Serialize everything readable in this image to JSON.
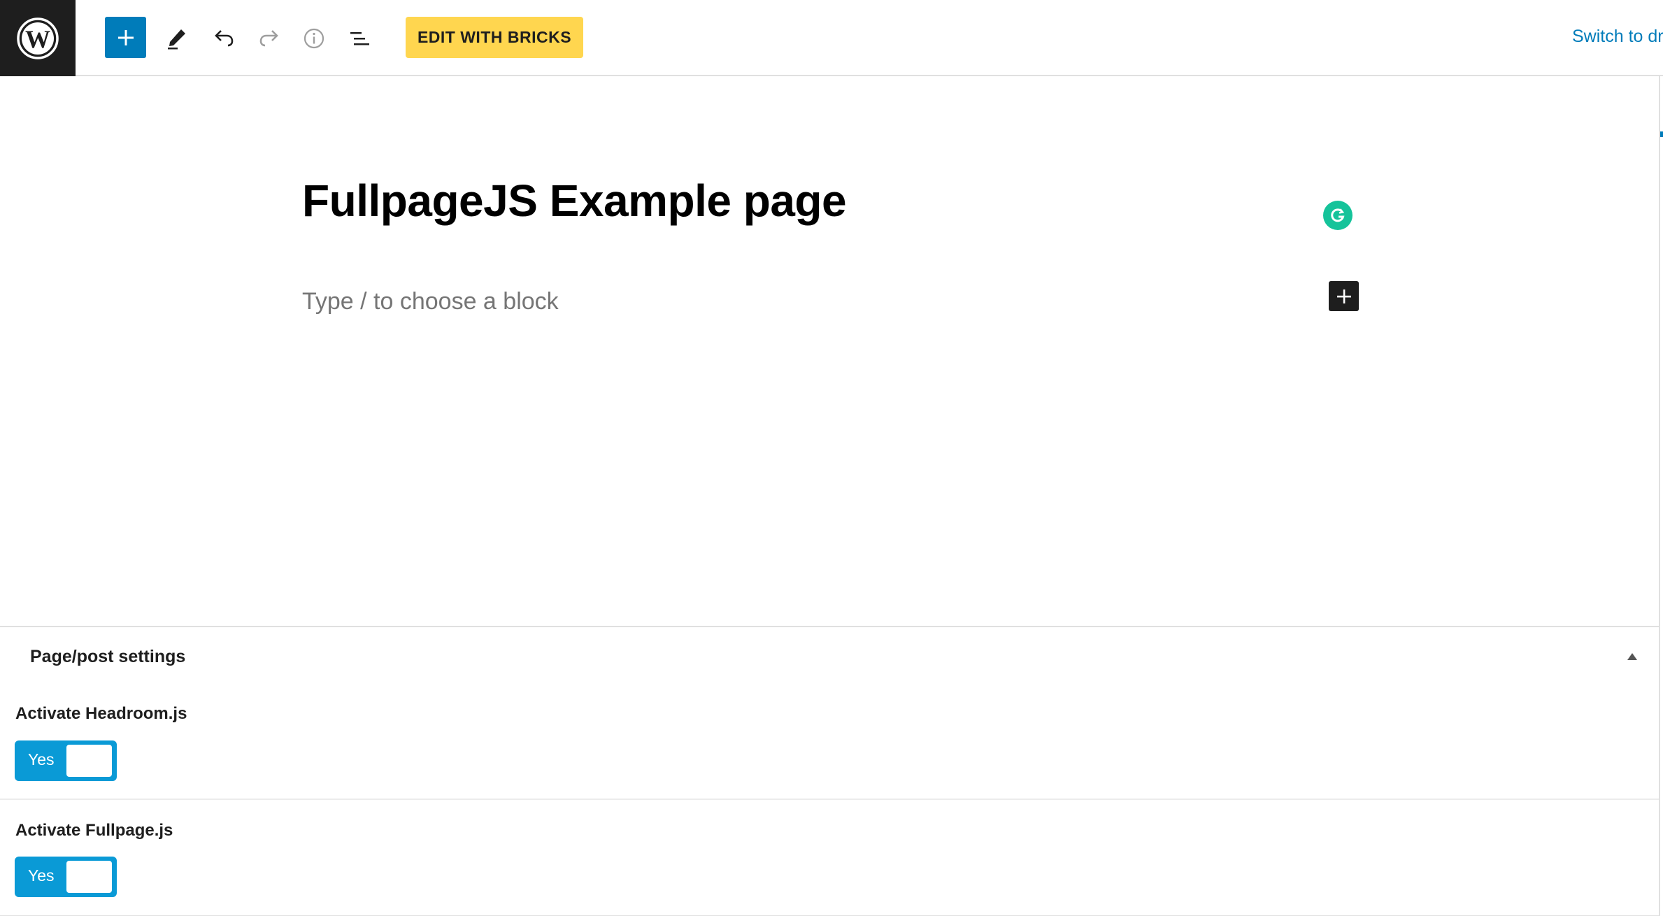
{
  "toolbar": {
    "bricks_label": "EDIT WITH BRICKS",
    "switch_label": "Switch to dr"
  },
  "editor": {
    "post_title": "FullpageJS Example page",
    "block_placeholder": "Type / to choose a block"
  },
  "metabox": {
    "title": "Page/post settings",
    "fields": [
      {
        "label": "Activate Headroom.js",
        "value": "Yes"
      },
      {
        "label": "Activate Fullpage.js",
        "value": "Yes"
      }
    ]
  },
  "colors": {
    "accent": "#007cba",
    "bricks": "#ffd64f",
    "toggle": "#0a9ad6",
    "grammarly": "#15c39a",
    "dark": "#1e1e1e"
  },
  "icons": [
    "wordpress-logo-icon",
    "plus-icon",
    "pencil-icon",
    "undo-icon",
    "redo-icon",
    "info-icon",
    "list-view-icon",
    "grammarly-icon",
    "block-add-plus-icon",
    "collapse-triangle-icon"
  ]
}
